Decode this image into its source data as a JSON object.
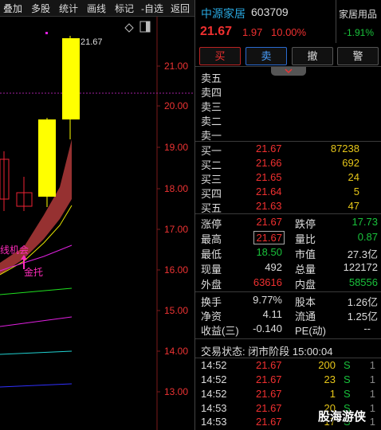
{
  "toolbar": [
    "叠加",
    "多股",
    "统计",
    "画线",
    "标记",
    "-自选",
    "返回"
  ],
  "chart": {
    "price_labels": [
      "21.00",
      "20.00",
      "19.00",
      "18.00",
      "17.00",
      "16.00",
      "15.00",
      "14.00",
      "13.00"
    ],
    "high_label": "21.67",
    "annotation_1": "线机会",
    "annotation_2": "金托"
  },
  "stock": {
    "name": "中源家居",
    "code": "603709",
    "sector": "家居用品",
    "sector_change": "-1.91%",
    "price": "21.67",
    "change": "1.97",
    "change_pct": "10.00%"
  },
  "buttons": {
    "buy": "买",
    "sell": "卖",
    "cancel": "撤",
    "alert": "警"
  },
  "asks": [
    {
      "label": "卖五",
      "price": "",
      "vol": ""
    },
    {
      "label": "卖四",
      "price": "",
      "vol": ""
    },
    {
      "label": "卖三",
      "price": "",
      "vol": ""
    },
    {
      "label": "卖二",
      "price": "",
      "vol": ""
    },
    {
      "label": "卖一",
      "price": "",
      "vol": ""
    }
  ],
  "bids": [
    {
      "label": "买一",
      "price": "21.67",
      "vol": "87238"
    },
    {
      "label": "买二",
      "price": "21.66",
      "vol": "692"
    },
    {
      "label": "买三",
      "price": "21.65",
      "vol": "24"
    },
    {
      "label": "买四",
      "price": "21.64",
      "vol": "5"
    },
    {
      "label": "买五",
      "price": "21.63",
      "vol": "47"
    }
  ],
  "stats": {
    "limit_up_label": "涨停",
    "limit_up": "21.67",
    "limit_down_label": "跌停",
    "limit_down": "17.73",
    "high_label": "最高",
    "high": "21.67",
    "vol_ratio_label": "量比",
    "vol_ratio": "0.87",
    "low_label": "最低",
    "low": "18.50",
    "mkt_cap_label": "市值",
    "mkt_cap": "27.3亿",
    "cur_vol_label": "现量",
    "cur_vol": "492",
    "total_vol_label": "总量",
    "total_vol": "122172",
    "outer_label": "外盘",
    "outer": "63616",
    "inner_label": "内盘",
    "inner": "58556",
    "turnover_label": "换手",
    "turnover": "9.77%",
    "share_cap_label": "股本",
    "share_cap": "1.26亿",
    "nav_label": "净资",
    "nav": "4.11",
    "float_label": "流通",
    "float": "1.25亿",
    "eps_label": "收益(三)",
    "eps": "-0.140",
    "pe_label": "PE(动)",
    "pe": "--"
  },
  "trade_status": "交易状态: 闭市阶段 15:00:04",
  "ticks": [
    {
      "time": "14:52",
      "price": "21.67",
      "vol": "200",
      "side": "S",
      "count": "1"
    },
    {
      "time": "14:52",
      "price": "21.67",
      "vol": "23",
      "side": "S",
      "count": "1"
    },
    {
      "time": "14:52",
      "price": "21.67",
      "vol": "1",
      "side": "S",
      "count": "1"
    },
    {
      "time": "14:53",
      "price": "21.67",
      "vol": "20",
      "side": "S",
      "count": "1"
    },
    {
      "time": "14:53",
      "price": "21.67",
      "vol": "17",
      "side": "S",
      "count": "1"
    }
  ],
  "watermark": "股海游侠"
}
